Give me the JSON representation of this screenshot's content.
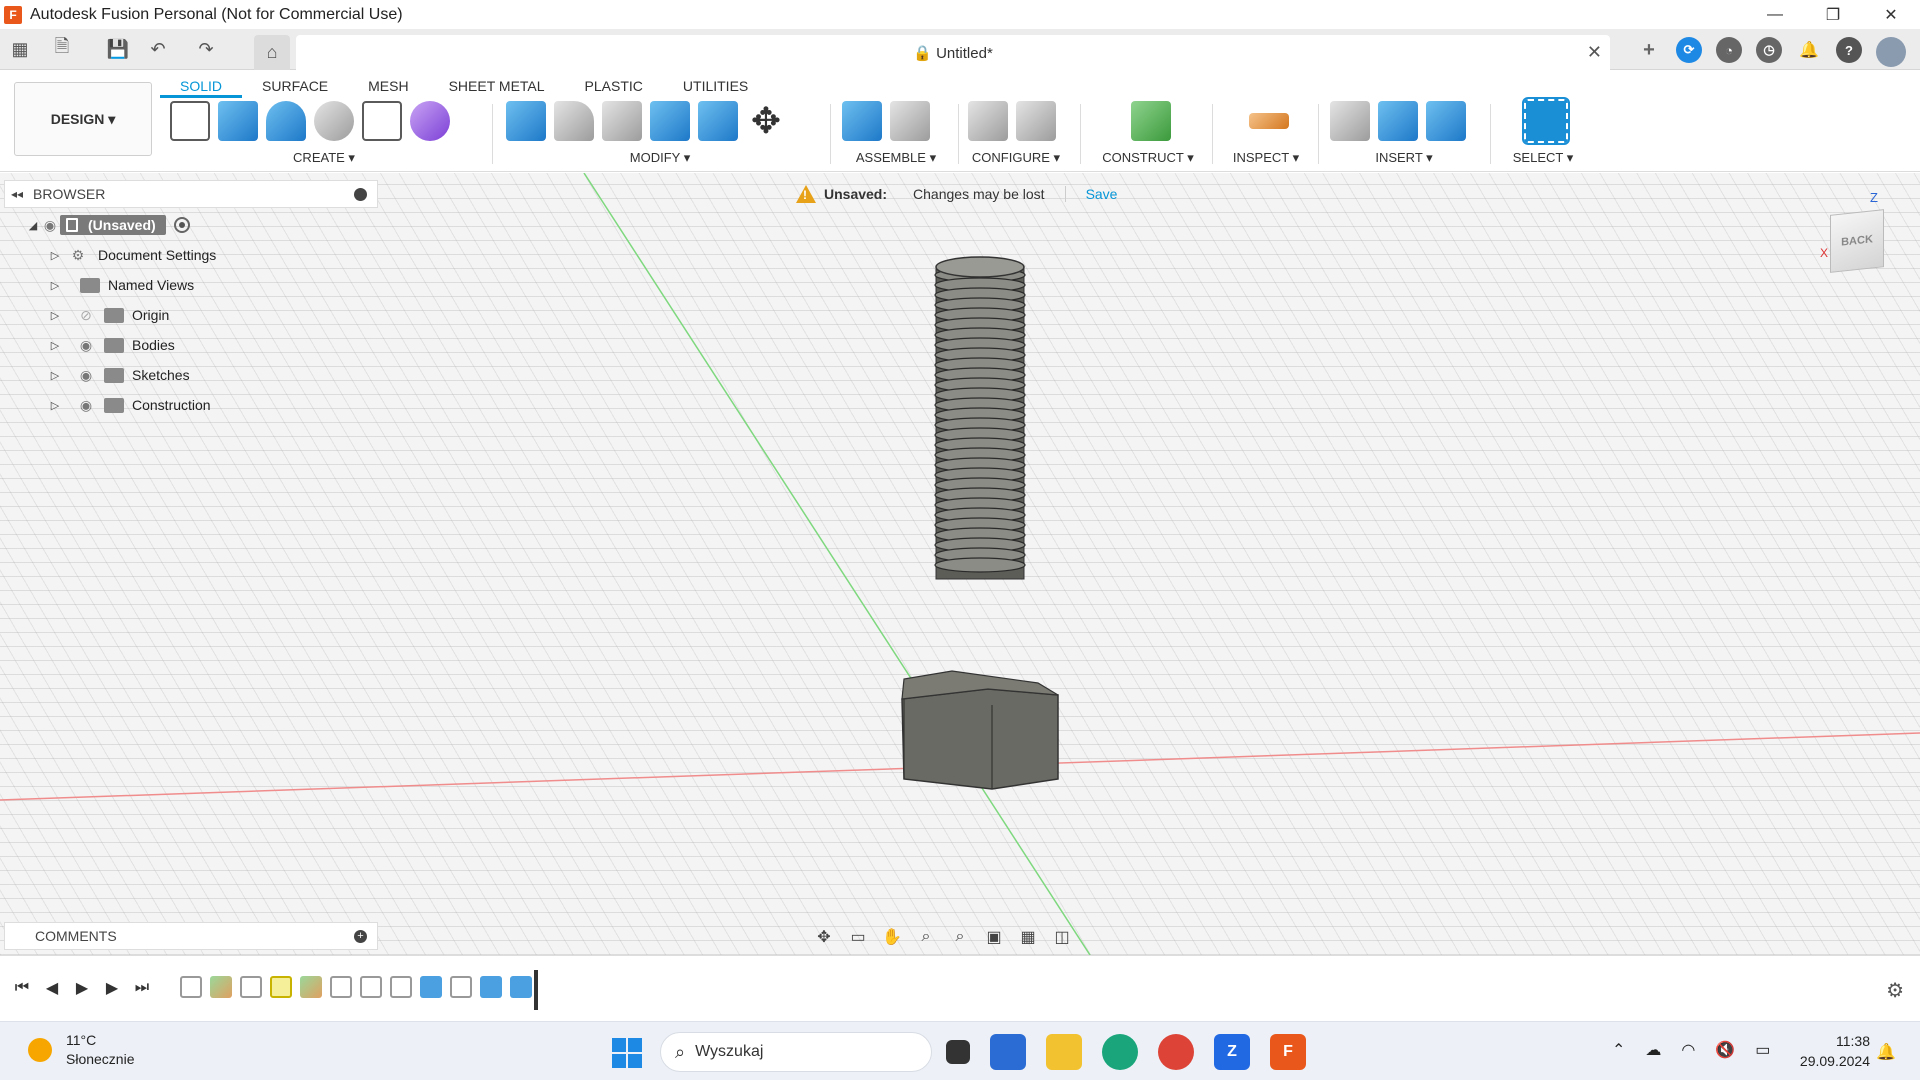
{
  "window": {
    "title": "Autodesk Fusion Personal (Not for Commercial Use)",
    "app_logo_letter": "F",
    "minimize": "—",
    "maximize": "❐",
    "close": "✕"
  },
  "quickbar": {
    "doc_title": "Untitled*",
    "close_tab": "✕"
  },
  "ribbon": {
    "workspace": "DESIGN ▾",
    "tabs": [
      "SOLID",
      "SURFACE",
      "MESH",
      "SHEET METAL",
      "PLASTIC",
      "UTILITIES"
    ],
    "groups": {
      "create": "CREATE ▾",
      "modify": "MODIFY ▾",
      "assemble": "ASSEMBLE ▾",
      "configure": "CONFIGURE ▾",
      "construct": "CONSTRUCT ▾",
      "inspect": "INSPECT ▾",
      "insert": "INSERT ▾",
      "select": "SELECT ▾"
    }
  },
  "browser": {
    "title": "BROWSER",
    "root": "(Unsaved)",
    "items": [
      "Document Settings",
      "Named Views",
      "Origin",
      "Bodies",
      "Sketches",
      "Construction"
    ]
  },
  "notice": {
    "title": "Unsaved:",
    "message": "Changes may be lost",
    "action": "Save"
  },
  "viewcube": {
    "face": "BACK",
    "z": "Z",
    "x": "X"
  },
  "comments": {
    "title": "COMMENTS"
  },
  "taskbar": {
    "temperature": "11°C",
    "weather": "Słonecznie",
    "search_placeholder": "Wyszukaj",
    "time": "11:38",
    "date": "29.09.2024"
  },
  "colors": {
    "accent": "#0696d7",
    "warning": "#e8a21a",
    "fusion_orange": "#e9581a"
  }
}
